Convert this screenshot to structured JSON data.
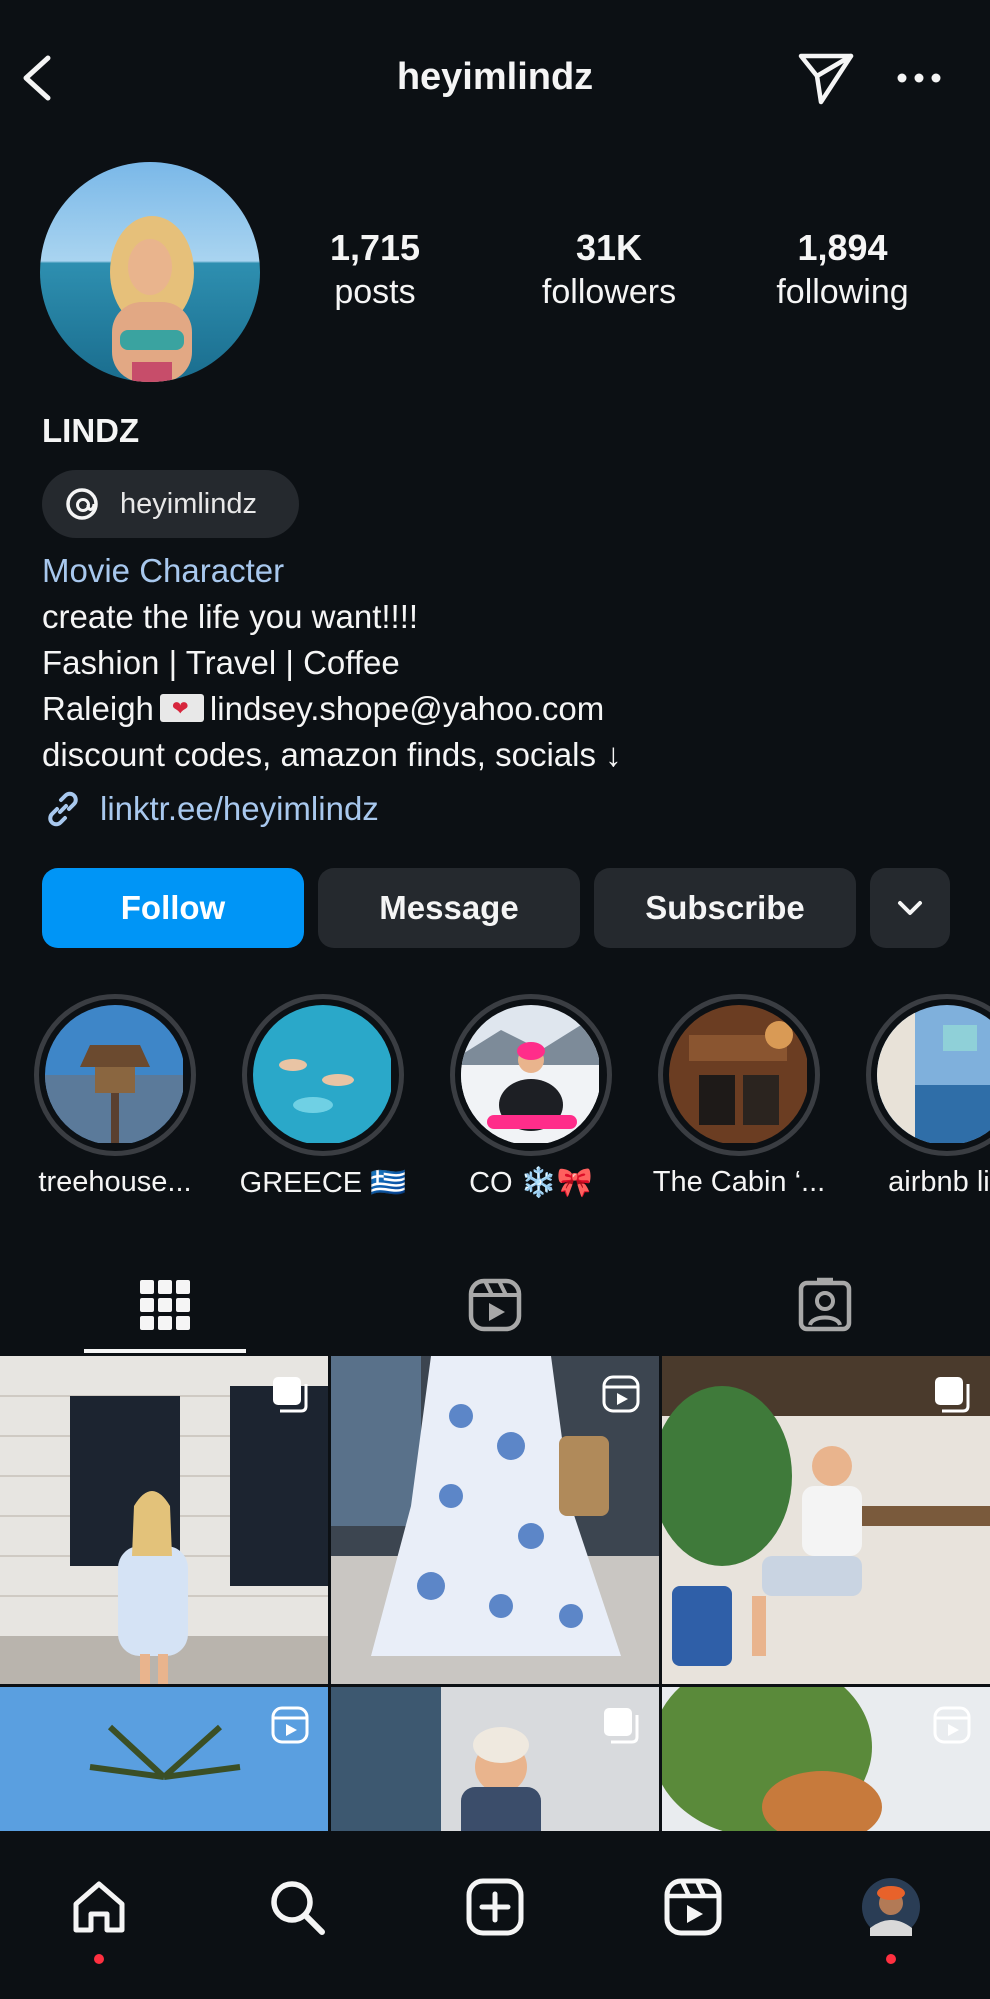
{
  "header": {
    "username": "heyimlindz",
    "icons": [
      "back-arrow-icon",
      "send-icon",
      "more-icon"
    ]
  },
  "profile": {
    "stats": {
      "posts_count": "1,715",
      "posts_label": "posts",
      "followers_count": "31K",
      "followers_label": "followers",
      "following_count": "1,894",
      "following_label": "following"
    },
    "display_name": "LINDZ",
    "threads_handle": "heyimlindz",
    "category": "Movie Character",
    "bio_line1": "create the life you want!!!!",
    "bio_line2": "Fashion | Travel | Coffee",
    "bio_line3_city": "Raleigh",
    "bio_line3_email": "lindsey.shope@yahoo.com",
    "bio_line4": "discount codes, amazon finds, socials ↓",
    "link": "linktr.ee/heyimlindz"
  },
  "actions": {
    "follow": "Follow",
    "message": "Message",
    "subscribe": "Subscribe"
  },
  "highlights": [
    {
      "label": "treehouse..."
    },
    {
      "label": "GREECE 🇬🇷"
    },
    {
      "label": "CO ❄️🎀"
    },
    {
      "label": "The Cabin ‘..."
    },
    {
      "label": "airbnb lin"
    }
  ],
  "tabs": [
    "grid-icon",
    "reels-icon",
    "tagged-icon"
  ],
  "colors": {
    "background": "#0c1014",
    "accent": "#0095f6",
    "secondary_button": "#25292e",
    "link": "#a8c8ee",
    "notification_dot": "#ff3040"
  }
}
